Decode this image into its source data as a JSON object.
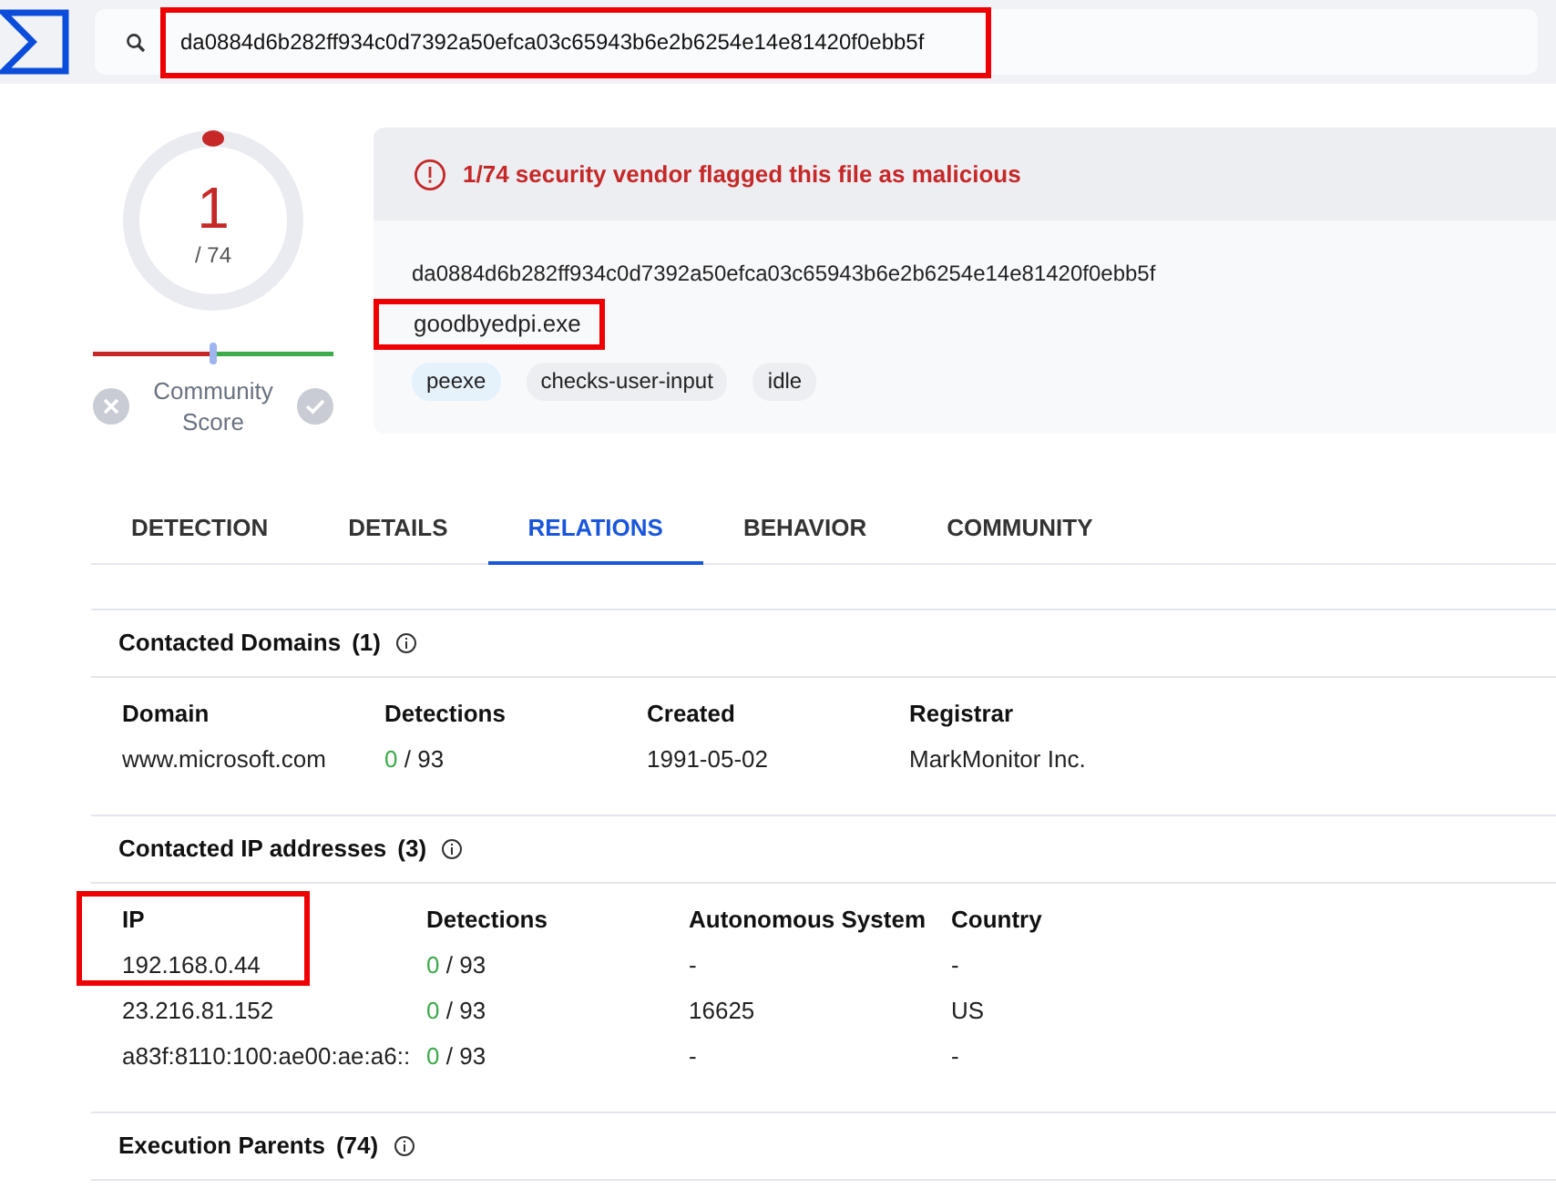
{
  "search": {
    "value": "da0884d6b282ff934c0d7392a50efca03c65943b6e2b6254e14e81420f0ebb5f",
    "highlighted": true
  },
  "score": {
    "detections": "1",
    "total": "/ 74",
    "community_label": "Community Score"
  },
  "file": {
    "alert": "1/74 security vendor flagged this file as malicious",
    "hash": "da0884d6b282ff934c0d7392a50efca03c65943b6e2b6254e14e81420f0ebb5f",
    "name": "goodbyedpi.exe",
    "name_highlighted": true,
    "tags": [
      {
        "label": "peexe",
        "color": "#e5f1fb"
      },
      {
        "label": "checks-user-input",
        "color": "#eceef2"
      },
      {
        "label": "idle",
        "color": "#eceef2"
      }
    ]
  },
  "tabs": [
    {
      "label": "DETECTION",
      "selected": false
    },
    {
      "label": "DETAILS",
      "selected": false
    },
    {
      "label": "RELATIONS",
      "selected": true
    },
    {
      "label": "BEHAVIOR",
      "selected": false
    },
    {
      "label": "COMMUNITY",
      "selected": false
    }
  ],
  "sections": [
    {
      "title": "Contacted Domains",
      "count": "(1)",
      "columns": [
        "Domain",
        "Detections",
        "Created",
        "Registrar"
      ],
      "rows": [
        [
          "www.microsoft.com",
          {
            "hits": "0",
            "total": "/ 93"
          },
          "1991-05-02",
          "MarkMonitor Inc."
        ]
      ]
    },
    {
      "title": "Contacted IP addresses",
      "count": "(3)",
      "highlight_first_row": true,
      "columns": [
        "IP",
        "Detections",
        "Autonomous System",
        "Country"
      ],
      "rows": [
        [
          "192.168.0.44",
          {
            "hits": "0",
            "total": "/ 93"
          },
          "-",
          "-"
        ],
        [
          "23.216.81.152",
          {
            "hits": "0",
            "total": "/ 93"
          },
          "16625",
          "US"
        ],
        [
          "a83f:8110:100:ae00:ae:a6::",
          {
            "hits": "0",
            "total": "/ 93"
          },
          "-",
          "-"
        ]
      ]
    },
    {
      "title": "Execution Parents",
      "count": "(74)"
    }
  ]
}
